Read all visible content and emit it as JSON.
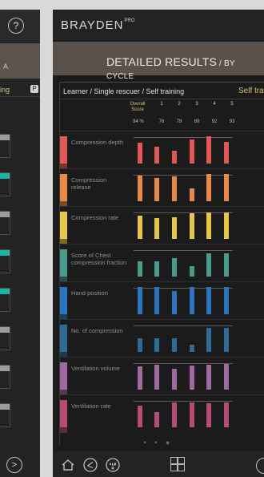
{
  "left_screen": {
    "help_glyph": "?",
    "band_text": "A",
    "header_text": "ing",
    "header_badge": "P",
    "next_glyph": ">"
  },
  "brand": {
    "name": "BRAYDEN",
    "tag": "PRO"
  },
  "title": {
    "main": "DETAILED RESULTS",
    "sub": "/ BY CYCLE"
  },
  "panel": {
    "learner": "Learner / Single rescuer / Self training",
    "mode": "Self trai"
  },
  "columns": {
    "overall_label_line1": "Overall",
    "overall_label_line2": "Score",
    "overall_pct": "84 %",
    "cycles": [
      "1",
      "2",
      "3",
      "4",
      "5"
    ],
    "cycle_pcts": [
      "76",
      "79",
      "89",
      "92",
      "93"
    ]
  },
  "metrics": [
    {
      "label": "Compression depth",
      "color": "#e05a55",
      "dark": "#7a3330",
      "values": [
        0.75,
        0.63,
        0.48,
        0.88,
        1.0,
        0.78
      ]
    },
    {
      "label": "Compression release",
      "color": "#e8894a",
      "dark": "#7d4a28",
      "values": [
        0.95,
        0.85,
        0.92,
        0.48,
        1.0,
        1.0
      ]
    },
    {
      "label": "Compression rate",
      "color": "#e7c54a",
      "dark": "#7c6a28",
      "values": [
        0.85,
        0.75,
        0.78,
        0.95,
        0.98,
        0.98
      ]
    },
    {
      "label": "Score of Chest compression fraction",
      "color": "#4a9b8e",
      "dark": "#294f49",
      "values": [
        0.55,
        0.55,
        0.68,
        0.38,
        0.85,
        0.85
      ]
    },
    {
      "label": "Hand position",
      "color": "#2a74c0",
      "dark": "#1a3f66",
      "values": [
        1.0,
        1.0,
        0.85,
        1.0,
        1.0,
        1.0
      ]
    },
    {
      "label": "No. of compression",
      "color": "#2e6c95",
      "dark": "#1b3a51",
      "values": [
        0.5,
        0.5,
        0.5,
        0.25,
        0.88,
        0.88
      ]
    },
    {
      "label": "Ventilation volume",
      "color": "#a06aa0",
      "dark": "#553856",
      "values": [
        0.85,
        0.92,
        0.75,
        0.88,
        0.92,
        0.95
      ]
    },
    {
      "label": "Ventilation rate",
      "color": "#b54b76",
      "dark": "#5f2840",
      "values": [
        0.78,
        0.55,
        0.92,
        0.92,
        0.88,
        0.92
      ]
    }
  ],
  "pager": {
    "dots": "• • ●"
  },
  "footer": {
    "icons": [
      "home-icon",
      "share-icon",
      "xls-export-icon",
      "grid-icon",
      "next-icon"
    ]
  }
}
